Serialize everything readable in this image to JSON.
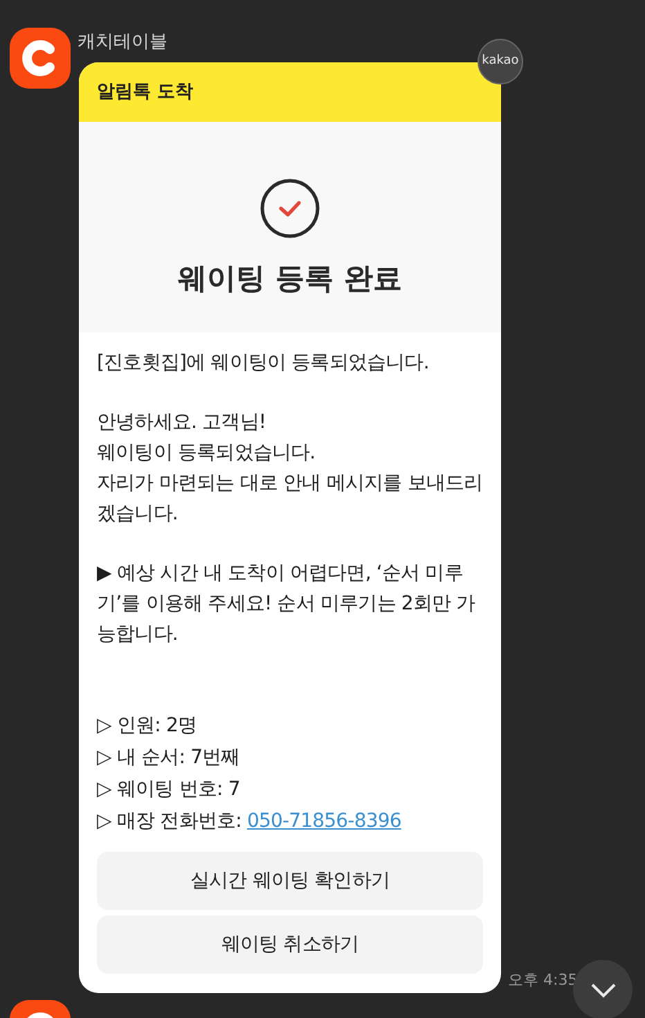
{
  "sender": {
    "name": "캐치테이블"
  },
  "badge": "kakao",
  "card": {
    "header": "알림톡 도착",
    "title": "웨이팅 등록 완료",
    "paragraphs": [
      "[진호횟집]에 웨이팅이 등록되었습니다.",
      "안녕하세요. 고객님!\n웨이팅이 등록되었습니다.\n자리가 마련되는 대로 안내 메시지를 보내드리겠습니다.",
      "▶ 예상 시간 내 도착이 어렵다면, ‘순서 미루기’를 이용해 주세요! 순서 미루기는 2회만 가능합니다."
    ],
    "details": [
      {
        "text": "▷ 인원: 2명"
      },
      {
        "text": "▷ 내 순서: 7번째"
      },
      {
        "text": "▷ 웨이팅 번호: 7"
      },
      {
        "text": "▷ 매장 전화번호:",
        "link": "050-71856-8396"
      }
    ],
    "buttons": [
      "실시간 웨이팅 확인하기",
      "웨이팅 취소하기"
    ]
  },
  "timestamp": "오후 4:35"
}
